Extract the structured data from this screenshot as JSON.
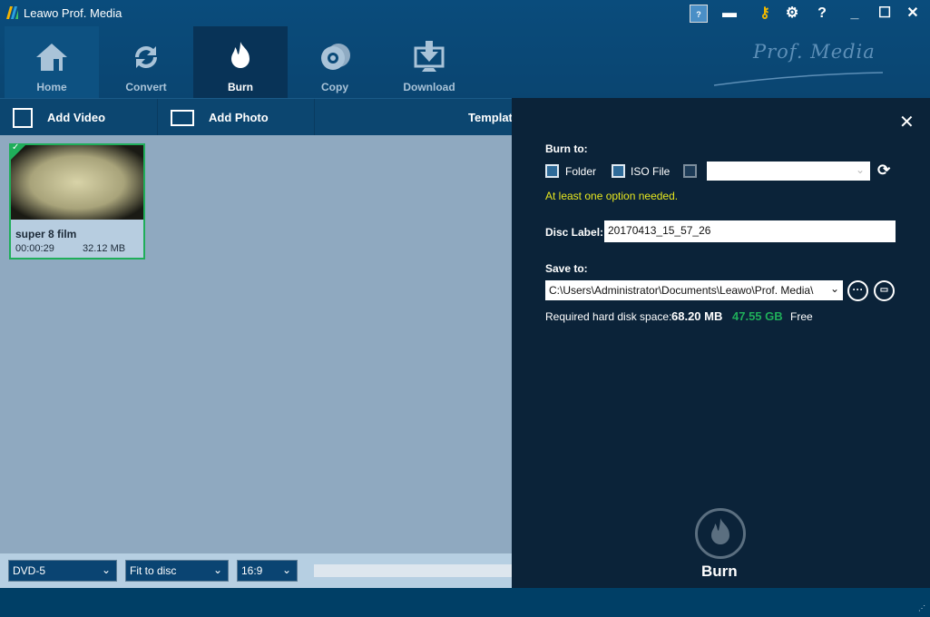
{
  "app": {
    "title": "Leawo Prof. Media",
    "brand": "Prof. Media"
  },
  "nav": [
    {
      "label": "Home"
    },
    {
      "label": "Convert"
    },
    {
      "label": "Burn"
    },
    {
      "label": "Copy"
    },
    {
      "label": "Download"
    }
  ],
  "toolbar": {
    "add_video": "Add Video",
    "add_photo": "Add Photo",
    "template": "Template"
  },
  "media": [
    {
      "title": "super 8 film",
      "duration": "00:00:29",
      "size": "32.12 MB"
    }
  ],
  "bottom": {
    "disc_type": "DVD-5",
    "quality": "Fit to disc",
    "aspect": "16:9"
  },
  "panel": {
    "burn_to_label": "Burn to:",
    "folder": "Folder",
    "iso": "ISO File",
    "drive_value": "",
    "warning": "At least one option needed.",
    "disc_label_label": "Disc Label:",
    "disc_label_value": "20170413_15_57_26",
    "save_to_label": "Save to:",
    "save_to_value": "C:\\Users\\Administrator\\Documents\\Leawo\\Prof. Media\\",
    "required_label": "Required hard disk space:",
    "required_value": "68.20 MB",
    "free_value": "47.55 GB",
    "free_label": "Free",
    "burn_button": "Burn"
  },
  "colors": {
    "accent_green": "#1fae5a",
    "warning": "#e6e61f",
    "panel_bg": "#0b2339"
  }
}
